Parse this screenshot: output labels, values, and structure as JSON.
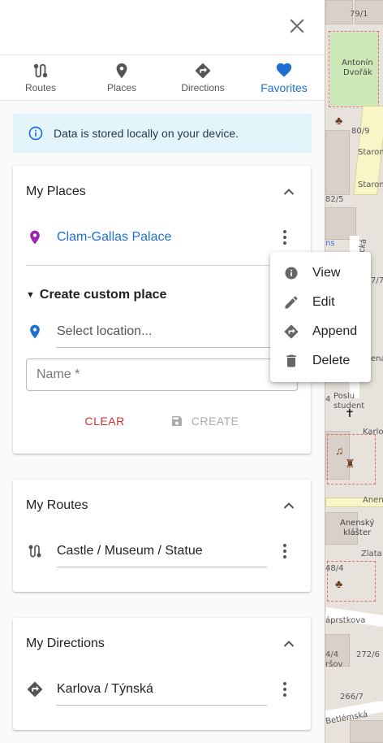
{
  "map": {
    "labels": [
      "79/1",
      "Antonín",
      "Dvořák",
      "80/9",
      "Staromě",
      "Staroměst",
      "82/5",
      "-ická",
      "ns",
      "7/7",
      "ená",
      "4",
      "Poslu",
      "student",
      "Karlo",
      "Anen",
      "Anenský",
      "klášter",
      "Zlata",
      "48/4",
      "áprstkova",
      "4/4",
      "272/6",
      "ršov",
      "266/7",
      "Betlémská"
    ]
  },
  "header": {
    "close_icon": "close-icon"
  },
  "tabs": [
    {
      "label": "Routes",
      "icon": "routes-icon"
    },
    {
      "label": "Places",
      "icon": "place-pin-icon"
    },
    {
      "label": "Directions",
      "icon": "directions-icon"
    },
    {
      "label": "Favorites",
      "icon": "heart-icon",
      "active": true
    }
  ],
  "info": {
    "text": "Data is stored locally on your device."
  },
  "places": {
    "title": "My Places",
    "items": [
      {
        "label": "Clam-Gallas Palace",
        "icon_color": "#9c27b0"
      }
    ],
    "custom": {
      "title": "Create custom place",
      "location_placeholder": "Select location...",
      "name_placeholder": "Name *",
      "clear_label": "CLEAR",
      "create_label": "CREATE"
    }
  },
  "routes": {
    "title": "My Routes",
    "items": [
      {
        "label": "Castle / Museum / Statue"
      }
    ]
  },
  "directions": {
    "title": "My Directions",
    "items": [
      {
        "label": "Karlova / Týnská"
      }
    ]
  },
  "context_menu": {
    "items": [
      {
        "label": "View",
        "icon": "info-icon"
      },
      {
        "label": "Edit",
        "icon": "pencil-icon"
      },
      {
        "label": "Append",
        "icon": "directions-icon"
      },
      {
        "label": "Delete",
        "icon": "trash-icon"
      }
    ]
  },
  "colors": {
    "accent": "#1e6fd0",
    "danger": "#d32f2f",
    "info_bg": "#e3f4fa"
  }
}
